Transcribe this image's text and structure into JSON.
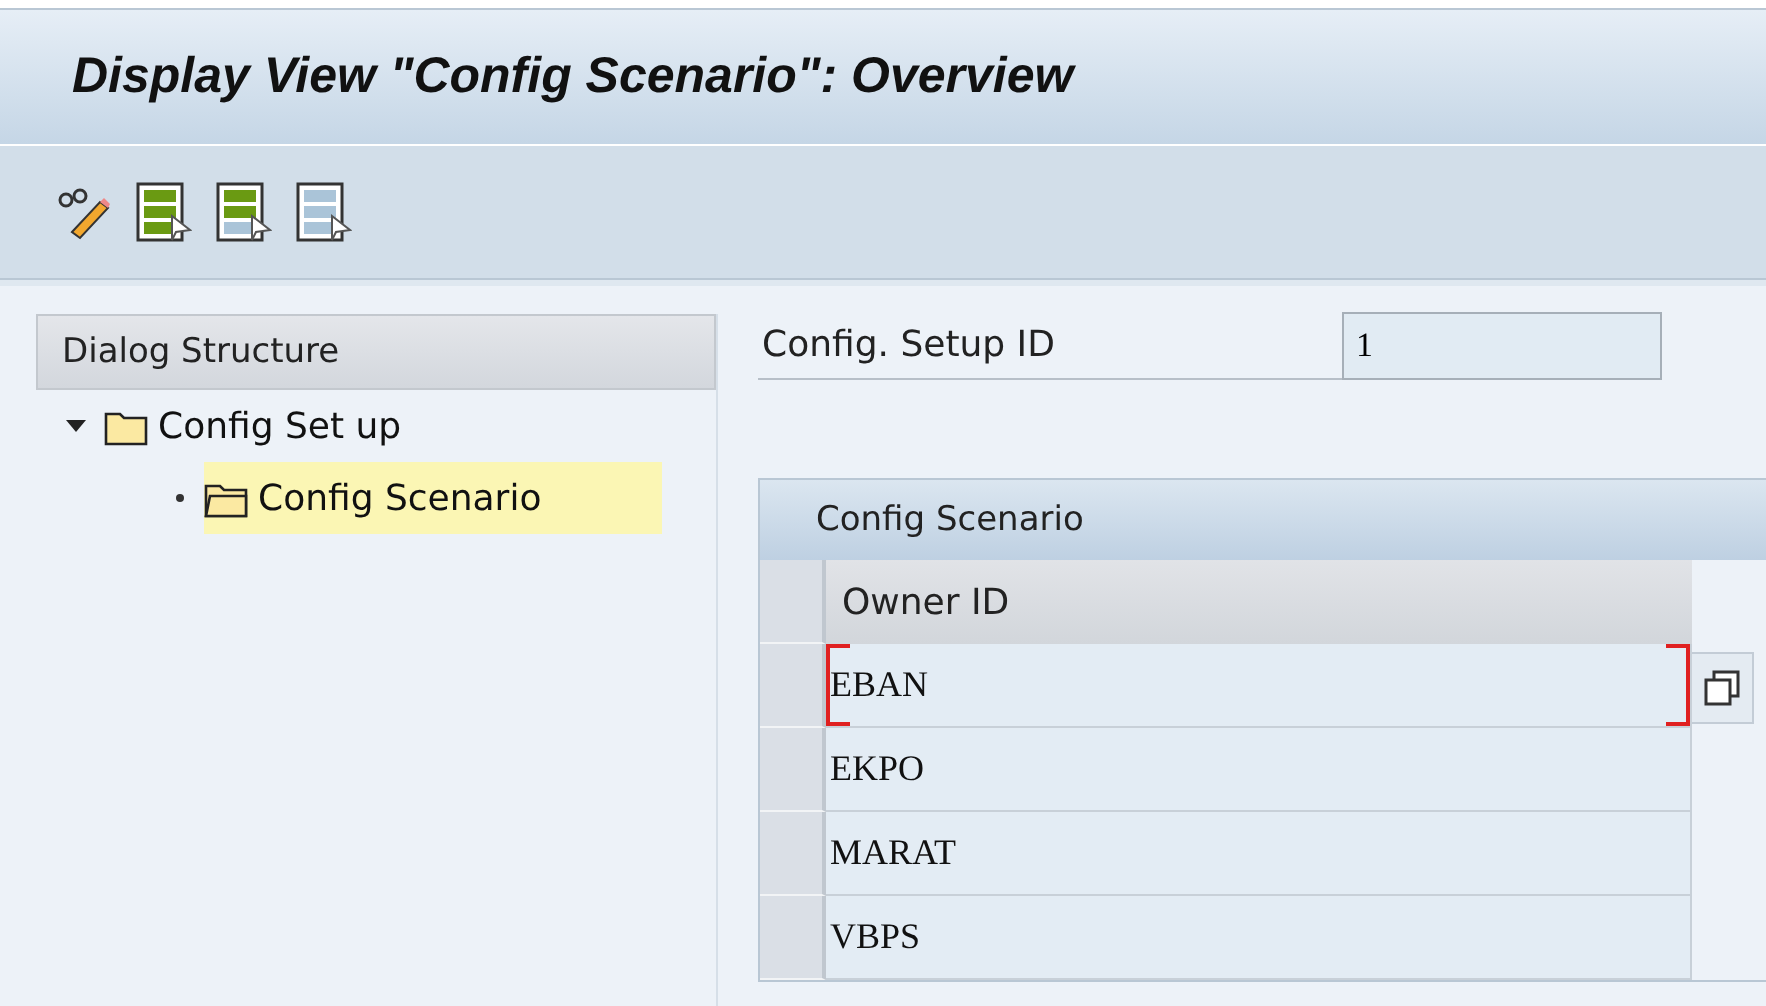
{
  "window": {
    "title": "Display View \"Config Scenario\": Overview"
  },
  "toolbar": [
    {
      "kind": "edit"
    },
    {
      "kind": "green-full"
    },
    {
      "kind": "green-half"
    },
    {
      "kind": "blue"
    }
  ],
  "sidebar": {
    "title": "Dialog Structure",
    "items": [
      {
        "label": "Config Set up",
        "selected": false,
        "expanded": true,
        "children": [
          {
            "label": "Config Scenario",
            "selected": true
          }
        ]
      }
    ]
  },
  "field": {
    "label": "Config. Setup ID",
    "value": "1"
  },
  "table": {
    "title": "Config Scenario",
    "columns": [
      "Owner ID"
    ],
    "rows": [
      {
        "cells": [
          "EBAN"
        ],
        "focused": true
      },
      {
        "cells": [
          "EKPO"
        ],
        "focused": false
      },
      {
        "cells": [
          "MARAT"
        ],
        "focused": false
      },
      {
        "cells": [
          "VBPS"
        ],
        "focused": false
      }
    ]
  }
}
